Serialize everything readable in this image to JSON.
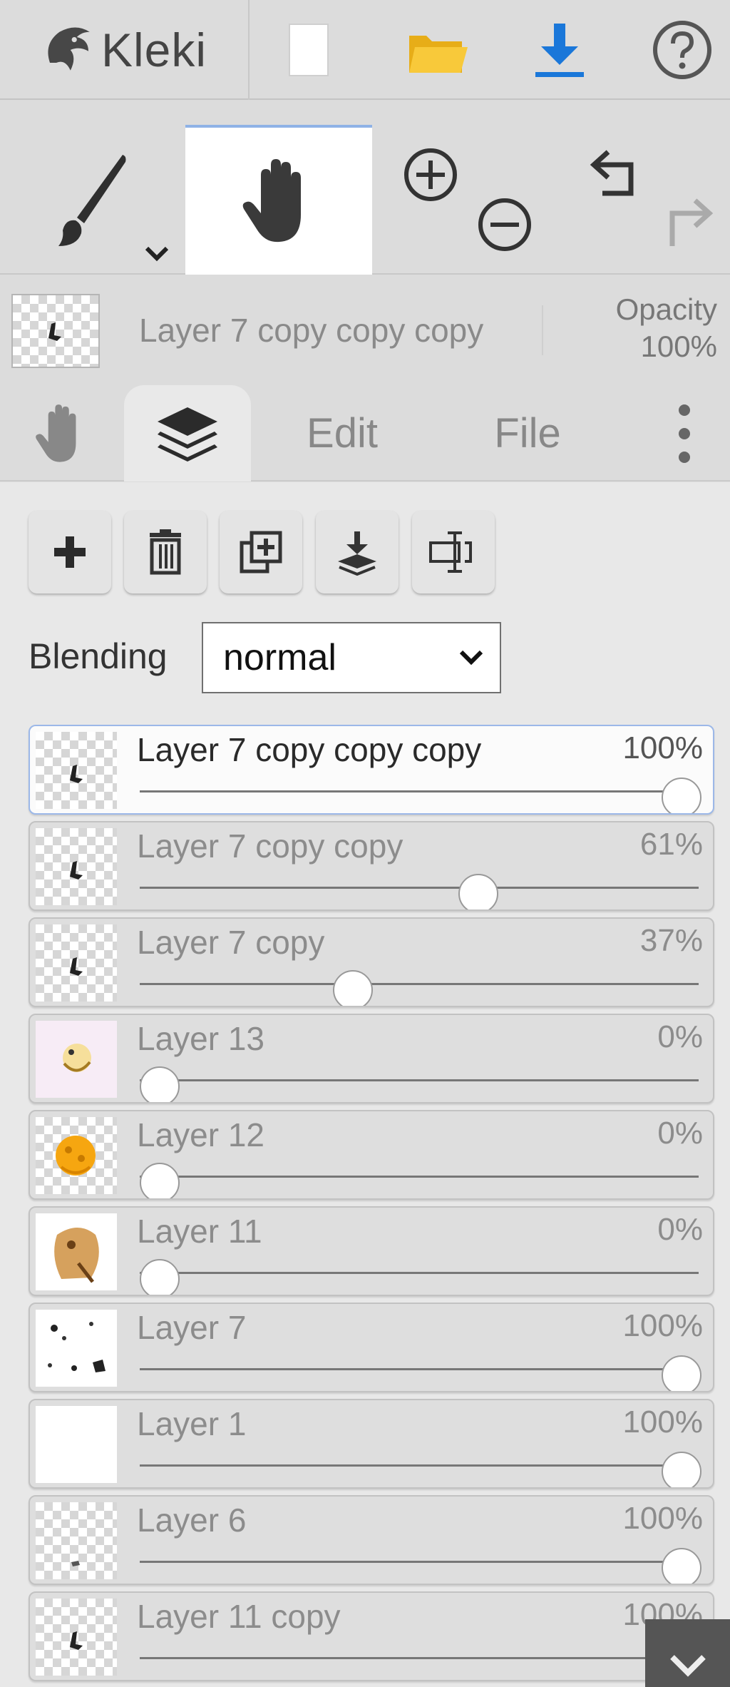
{
  "app": {
    "name": "Kleki"
  },
  "topbar": {
    "icons": [
      {
        "name": "new-document-icon",
        "color": "#ffffff"
      },
      {
        "name": "open-folder-icon",
        "color": "#f6c431"
      },
      {
        "name": "save-download-icon",
        "color": "#1a77d9"
      },
      {
        "name": "help-icon",
        "color": "#555555"
      }
    ]
  },
  "tools": {
    "brush": {
      "icon": "brush-icon"
    },
    "hand": {
      "icon": "hand-icon",
      "active": true
    },
    "zoom_in": {
      "icon": "zoom-in-icon"
    },
    "zoom_out": {
      "icon": "zoom-out-icon"
    },
    "undo": {
      "icon": "undo-icon"
    },
    "redo": {
      "icon": "redo-icon",
      "enabled": false
    }
  },
  "current_layer": {
    "name": "Layer 7 copy copy copy",
    "opacity_label": "Opacity",
    "opacity_value": "100%"
  },
  "tabs": {
    "hand": {
      "icon": "hand-icon"
    },
    "layers": {
      "icon": "layers-icon",
      "active": true
    },
    "edit": "Edit",
    "file": "File",
    "more": {
      "icon": "more-vertical-icon"
    }
  },
  "layer_actions": [
    {
      "name": "add-layer-button",
      "icon": "plus-icon"
    },
    {
      "name": "delete-layer-button",
      "icon": "trash-icon"
    },
    {
      "name": "duplicate-layer-button",
      "icon": "duplicate-icon"
    },
    {
      "name": "merge-down-button",
      "icon": "merge-down-icon"
    },
    {
      "name": "rename-layer-button",
      "icon": "rename-icon"
    }
  ],
  "blending": {
    "label": "Blending",
    "value": "normal"
  },
  "layers": [
    {
      "name": "Layer 7 copy copy copy",
      "opacity": "100%",
      "value": 1.0,
      "selected": true,
      "thumb": "checker-mark"
    },
    {
      "name": "Layer 7 copy copy",
      "opacity": "61%",
      "value": 0.61,
      "thumb": "checker-mark"
    },
    {
      "name": "Layer 7 copy",
      "opacity": "37%",
      "value": 0.37,
      "thumb": "checker-mark"
    },
    {
      "name": "Layer 13",
      "opacity": "0%",
      "value": 0.0,
      "thumb": "pink-figure"
    },
    {
      "name": "Layer 12",
      "opacity": "0%",
      "value": 0.0,
      "thumb": "orange-blob"
    },
    {
      "name": "Layer 11",
      "opacity": "0%",
      "value": 0.0,
      "thumb": "brown-figure"
    },
    {
      "name": "Layer 7",
      "opacity": "100%",
      "value": 1.0,
      "thumb": "white-specks"
    },
    {
      "name": "Layer 1",
      "opacity": "100%",
      "value": 1.0,
      "thumb": "white"
    },
    {
      "name": "Layer 6",
      "opacity": "100%",
      "value": 1.0,
      "thumb": "checker-dot"
    },
    {
      "name": "Layer 11 copy",
      "opacity": "100%",
      "value": 1.0,
      "thumb": "checker-mark"
    }
  ],
  "scroll_indicator": {
    "icon": "chevron-down-icon"
  }
}
